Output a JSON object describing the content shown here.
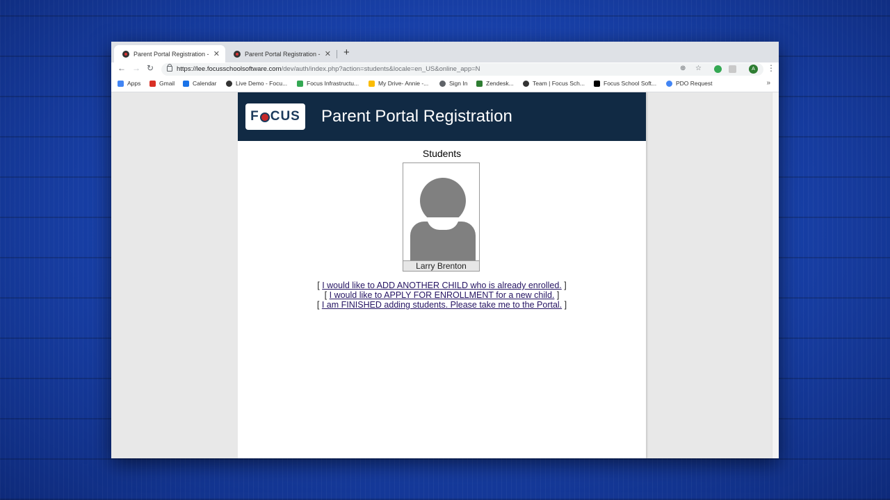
{
  "browser": {
    "tabs": [
      {
        "title": "Parent Portal Registration - Lee",
        "active": true
      },
      {
        "title": "Parent Portal Registration - Lee",
        "active": false
      }
    ],
    "new_tab": "+",
    "url_main": "https://lee.focusschoolsoftware.com",
    "url_rest": "/dev/auth/index.php?action=students&locale=en_US&online_app=N",
    "profile_initial": "A",
    "bookmarks": [
      {
        "label": "Apps",
        "icon": "apps-grid-icon",
        "color": "#4285f4"
      },
      {
        "label": "Gmail",
        "icon": "gmail-icon",
        "color": "#d93025"
      },
      {
        "label": "Calendar",
        "icon": "calendar-icon",
        "color": "#1a73e8"
      },
      {
        "label": "Live Demo - Focu...",
        "icon": "focus-icon",
        "color": "#333333"
      },
      {
        "label": "Focus Infrastructu...",
        "icon": "drive-icon",
        "color": "#34a853"
      },
      {
        "label": "My Drive- Annie -...",
        "icon": "drive-icon",
        "color": "#fbbc04"
      },
      {
        "label": "Sign In",
        "icon": "globe-icon",
        "color": "#5f6368"
      },
      {
        "label": "Zendesk...",
        "icon": "zendesk-icon",
        "color": "#2e7d32"
      },
      {
        "label": "Team | Focus Sch...",
        "icon": "focus-icon",
        "color": "#333333"
      },
      {
        "label": "Focus School Soft...",
        "icon": "plus-square-icon",
        "color": "#000000"
      },
      {
        "label": "PDO Request",
        "icon": "google-icon",
        "color": "#4285f4"
      }
    ],
    "more": "»"
  },
  "page": {
    "logo_text_f": "F",
    "logo_text_rest": "CUS",
    "title": "Parent Portal Registration",
    "students_heading": "Students",
    "student": {
      "name": "Larry Brenton"
    },
    "links": [
      {
        "prefix": "[ ",
        "text": "I would like to ADD ANOTHER CHILD who is already enrolled.",
        "suffix": " ]"
      },
      {
        "prefix": "[ ",
        "text": "I would like to APPLY FOR ENROLLMENT for a new child.",
        "suffix": " ]"
      },
      {
        "prefix": "[ ",
        "text": "I am FINISHED adding students. Please take me to the Portal.",
        "suffix": " ]"
      }
    ]
  },
  "colors": {
    "header_bg": "#112a44",
    "link": "#251463"
  }
}
